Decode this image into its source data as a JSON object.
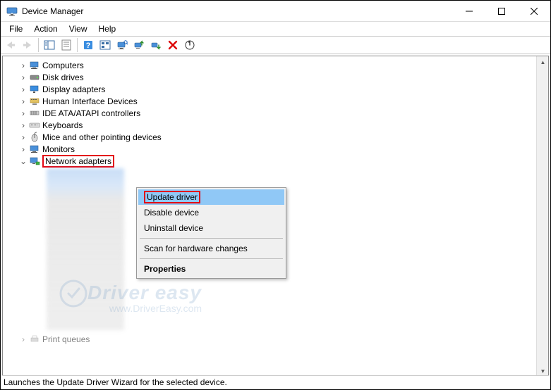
{
  "window": {
    "title": "Device Manager"
  },
  "menubar": {
    "file": "File",
    "action": "Action",
    "view": "View",
    "help": "Help"
  },
  "tree": {
    "items": [
      {
        "label": "Computers",
        "icon": "monitor"
      },
      {
        "label": "Disk drives",
        "icon": "drive"
      },
      {
        "label": "Display adapters",
        "icon": "display"
      },
      {
        "label": "Human Interface Devices",
        "icon": "hid"
      },
      {
        "label": "IDE ATA/ATAPI controllers",
        "icon": "ide"
      },
      {
        "label": "Keyboards",
        "icon": "keyboard"
      },
      {
        "label": "Mice and other pointing devices",
        "icon": "mouse"
      },
      {
        "label": "Monitors",
        "icon": "monitor2"
      }
    ],
    "expanded": {
      "label": "Network adapters",
      "icon": "network"
    },
    "last": {
      "label": "Print queues",
      "icon": "printer"
    }
  },
  "context_menu": {
    "update": "Update driver",
    "disable": "Disable device",
    "uninstall": "Uninstall device",
    "scan": "Scan for hardware changes",
    "properties": "Properties"
  },
  "statusbar": {
    "text": "Launches the Update Driver Wizard for the selected device."
  },
  "watermark": {
    "main": "Driver easy",
    "sub": "www.DriverEasy.com"
  }
}
